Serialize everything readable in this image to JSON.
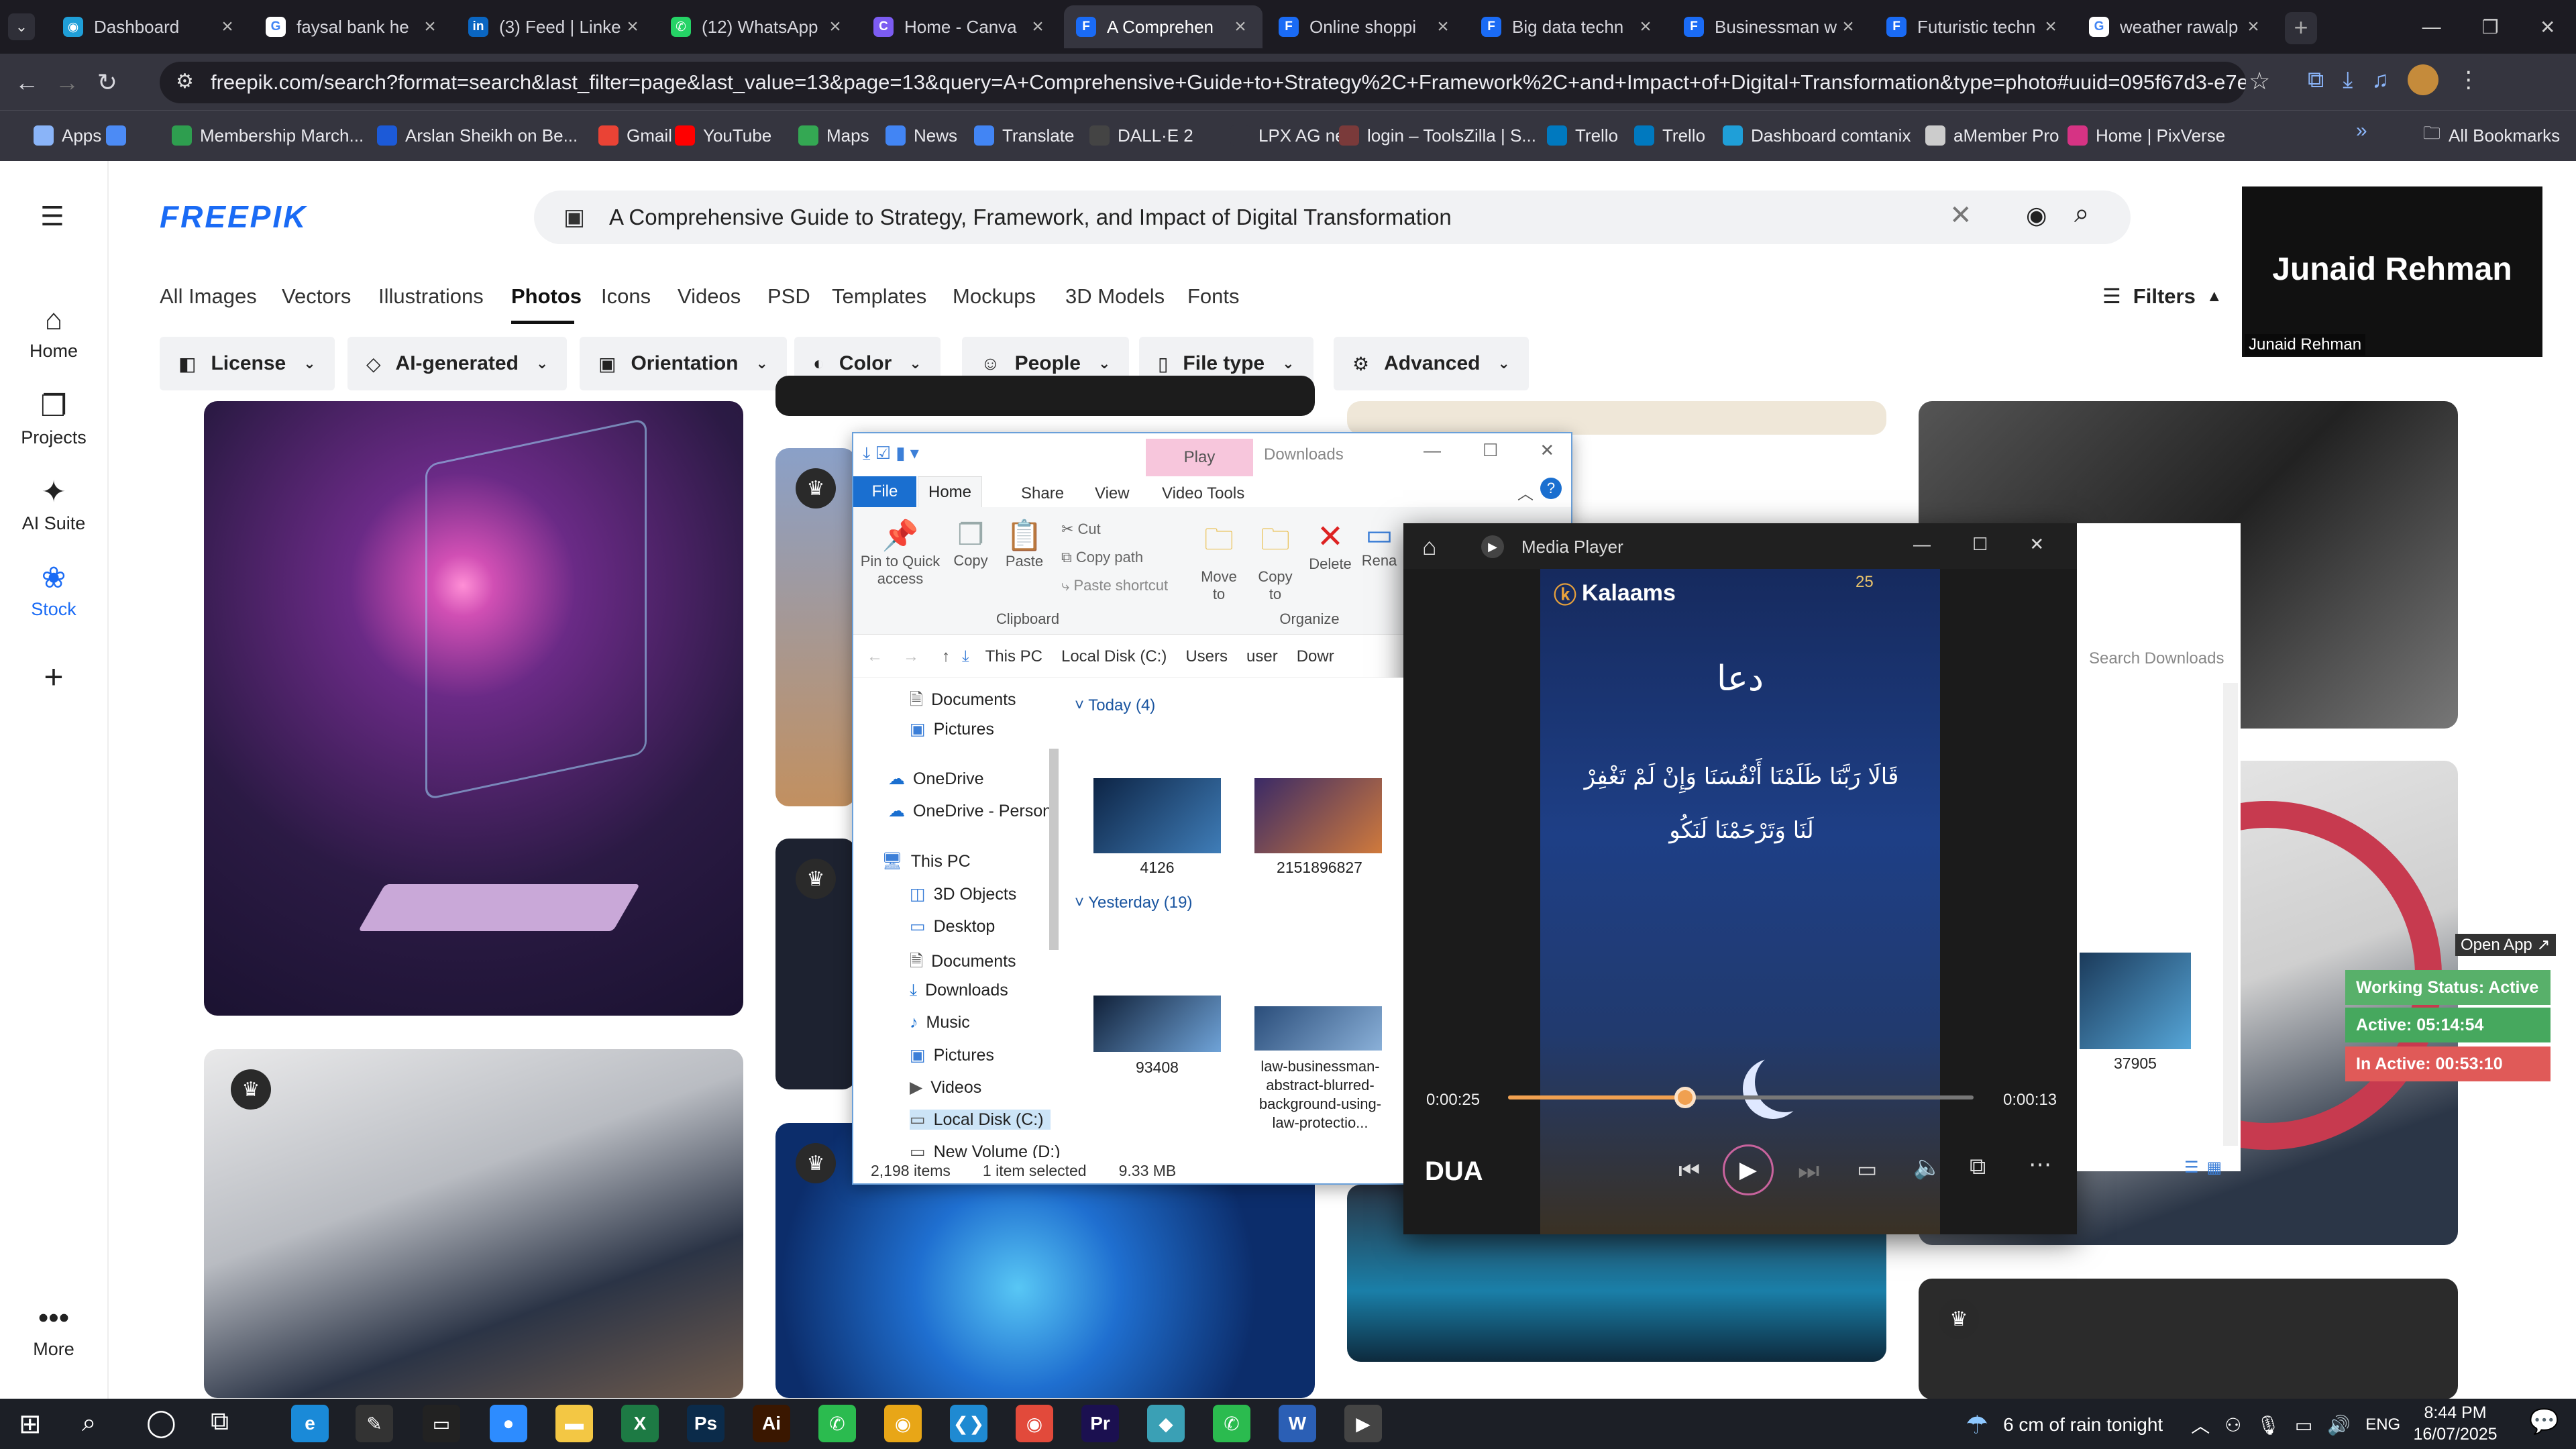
{
  "browser": {
    "tabs": [
      {
        "title": "Dashboard",
        "fav_color": "#1f9fd8",
        "fav": "◉"
      },
      {
        "title": "faysal bank he",
        "fav_color": "#ffffff",
        "fav": "G"
      },
      {
        "title": "(3) Feed | Linke",
        "fav_color": "#0a66c2",
        "fav": "in"
      },
      {
        "title": "(12) WhatsApp",
        "fav_color": "#25d366",
        "fav": "✆"
      },
      {
        "title": "Home - Canva",
        "fav_color": "#7c5cf2",
        "fav": "C"
      },
      {
        "title": "A Comprehen",
        "fav_color": "#1a6bf5",
        "fav": "F"
      },
      {
        "title": "Online shoppi",
        "fav_color": "#1a6bf5",
        "fav": "F"
      },
      {
        "title": "Big data techn",
        "fav_color": "#1a6bf5",
        "fav": "F"
      },
      {
        "title": "Businessman w",
        "fav_color": "#1a6bf5",
        "fav": "F"
      },
      {
        "title": "Futuristic techn",
        "fav_color": "#1a6bf5",
        "fav": "F"
      },
      {
        "title": "weather rawalp",
        "fav_color": "#ffffff",
        "fav": "G"
      }
    ],
    "url": "freepik.com/search?format=search&last_filter=page&last_value=13&page=13&query=A+Comprehensive+Guide+to+Strategy%2C+Framework%2C+and+Impact+of+Digital+Transformation&type=photo#uuid=095f67d3-e7ea-4500-be7d-a4...",
    "bookmarks": [
      {
        "label": "Apps",
        "color": "#8ab4f8"
      },
      {
        "label": "",
        "color": "#4c8bf5"
      },
      {
        "label": "Membership March...",
        "color": "#2e9e4f"
      },
      {
        "label": "Arslan Sheikh on Be...",
        "color": "#1c5ad8"
      },
      {
        "label": "Gmail",
        "color": "#ea4335"
      },
      {
        "label": "YouTube",
        "color": "#ff0000"
      },
      {
        "label": "Maps",
        "color": "#34a853"
      },
      {
        "label": "News",
        "color": "#4285f4"
      },
      {
        "label": "Translate",
        "color": "#4285f4"
      },
      {
        "label": "DALL·E 2",
        "color": "#444444"
      },
      {
        "label": "LPX AG new",
        "color": "#35353f"
      },
      {
        "label": "login – ToolsZilla | S...",
        "color": "#7a3a3a"
      },
      {
        "label": "Trello",
        "color": "#0079bf"
      },
      {
        "label": "Trello",
        "color": "#0079bf"
      },
      {
        "label": "Dashboard comtanix",
        "color": "#1f9fd8"
      },
      {
        "label": "aMember Pro",
        "color": "#cccccc"
      },
      {
        "label": "Home | PixVerse",
        "color": "#d63384"
      }
    ],
    "all_bookmarks": "All Bookmarks"
  },
  "freepik": {
    "logo": "FREEPIK",
    "search_query": "A Comprehensive Guide to Strategy, Framework, and Impact of Digital Transformation",
    "rail": [
      "Home",
      "Projects",
      "AI Suite",
      "Stock",
      "More"
    ],
    "categories": [
      "All Images",
      "Vectors",
      "Illustrations",
      "Photos",
      "Icons",
      "Videos",
      "PSD",
      "Templates",
      "Mockups",
      "3D Models",
      "Fonts"
    ],
    "active_category": "Photos",
    "filters_label": "Filters",
    "chips": [
      "License",
      "AI-generated",
      "Orientation",
      "Color",
      "People",
      "File type",
      "Advanced"
    ]
  },
  "explorer": {
    "title": "Downloads",
    "context_tab": "Play",
    "ribbon_tabs": [
      "File",
      "Home",
      "Share",
      "View",
      "Video Tools"
    ],
    "clipboard": {
      "pin": "Pin to Quick access",
      "copy": "Copy",
      "paste": "Paste",
      "cut": "Cut",
      "copy_path": "Copy path",
      "paste_shortcut": "Paste shortcut",
      "group": "Clipboard"
    },
    "organize": {
      "move": "Move to",
      "copy_to": "Copy to",
      "delete": "Delete",
      "rename": "Rena",
      "group": "Organize"
    },
    "path": [
      "This PC",
      "Local Disk (C:)",
      "Users",
      "user",
      "Dowr"
    ],
    "search_placeholder": "Search Downloads",
    "tree": [
      "Documents",
      "Pictures",
      "OneDrive",
      "OneDrive - Person",
      "This PC",
      "3D Objects",
      "Desktop",
      "Documents",
      "Downloads",
      "Music",
      "Pictures",
      "Videos",
      "Local Disk (C:)",
      "New Volume (D:)"
    ],
    "groups": [
      {
        "label": "Today (4)"
      },
      {
        "label": "Yesterday (19)"
      }
    ],
    "files": [
      "4126",
      "2151896827",
      "93408",
      "law-businessman-abstract-blurred-background-using-law-protectio...",
      "37905"
    ],
    "status": {
      "items": "2,198 items",
      "selected": "1 item selected",
      "size": "9.33 MB"
    }
  },
  "media": {
    "title": "Media Player",
    "brand": "Kalaams",
    "badge": "25",
    "heading": "دعا",
    "verse1": "قَالَا رَبَّنَا ظَلَمْنَا أَنْفُسَنَا وَإِنْ لَمْ تَغْفِرْ",
    "verse2": "لَنَا وَتَرْحَمْنَا لَنَكُو",
    "elapsed": "0:00:25",
    "remaining": "0:00:13",
    "progress": 0.38,
    "track": "DUA"
  },
  "overlay": {
    "name": "Junaid Rehman",
    "open_app": "Open App ↗",
    "working": "Working Status: Active",
    "active": "Active: 05:14:54",
    "inactive": "In Active: 00:53:10"
  },
  "taskbar": {
    "weather": "6 cm of rain tonight",
    "lang": "ENG",
    "time": "8:44 PM",
    "date": "16/07/2025"
  }
}
